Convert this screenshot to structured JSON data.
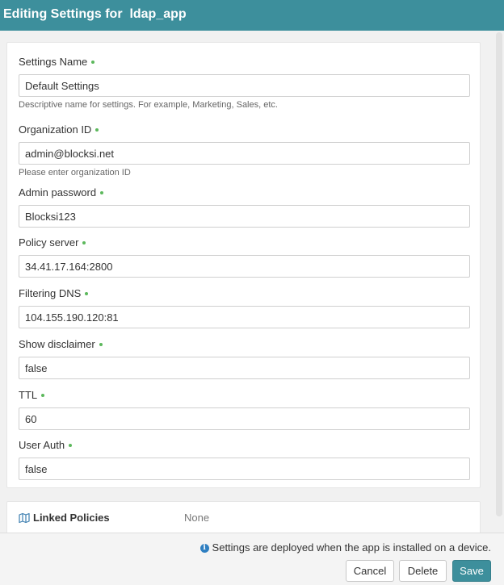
{
  "header": {
    "title": "Editing Settings for  ldap_app"
  },
  "form": {
    "fields": [
      {
        "label": "Settings Name",
        "value": "Default Settings",
        "help": "Descriptive name for settings. For example, Marketing, Sales, etc."
      },
      {
        "label": "Organization ID",
        "value": "admin@blocksi.net",
        "help": "Please enter organization ID"
      },
      {
        "label": "Admin password",
        "value": "Blocksi123"
      },
      {
        "label": "Policy server",
        "value": "34.41.17.164:2800"
      },
      {
        "label": "Filtering DNS",
        "value": "104.155.190.120:81"
      },
      {
        "label": "Show disclaimer",
        "value": "false"
      },
      {
        "label": "TTL",
        "value": "60"
      },
      {
        "label": "User Auth",
        "value": "false"
      }
    ]
  },
  "linked_policies": {
    "title": "Linked Policies",
    "value": "None",
    "icon": "map-icon"
  },
  "footer": {
    "note": "Settings are deployed when the app is installed on a device.",
    "note_icon": "info-icon",
    "cancel_label": "Cancel",
    "delete_label": "Delete",
    "save_label": "Save"
  },
  "colors": {
    "header_bg": "#3d8f9c",
    "required_dot": "#5cb85c",
    "info_icon": "#2f7fc1",
    "save_bg": "#3d8f9c"
  }
}
